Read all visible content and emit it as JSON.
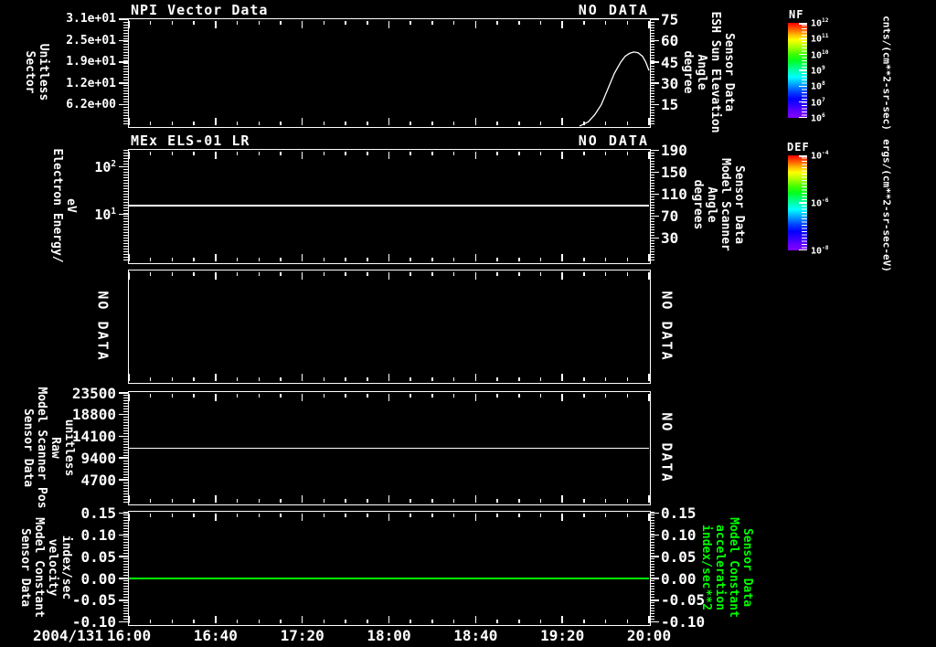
{
  "window": {
    "bg": "#000000",
    "fg": "#ffffff",
    "green": "#00ff00"
  },
  "x_axis": {
    "date_label": "2004/131",
    "tick_labels": [
      "16:00",
      "16:40",
      "17:20",
      "18:00",
      "18:40",
      "19:20",
      "20:00"
    ],
    "minors_between_majors": 3
  },
  "panels": [
    {
      "title": "NPI Vector Data",
      "status_top": "NO DATA",
      "left_label_lines": [
        "Sector",
        "Unitless"
      ],
      "right_label_lines": [
        "Sensor Data",
        "ESH Sun Elevation",
        "Angle",
        "degree"
      ]
    },
    {
      "title": "MEx ELS-01 LR",
      "status_top": "NO DATA",
      "left_label_lines": [
        "Electron Energy/",
        "eV"
      ],
      "right_label_lines": [
        "Sensor Data",
        "Model Scanner",
        "Angle",
        "degrees"
      ]
    },
    {
      "status_left": "NO DATA",
      "status_right": "NO DATA"
    },
    {
      "left_label_lines": [
        "Sensor Data",
        "Model Scanner Pos",
        "Raw",
        "unitless"
      ],
      "status_right": "NO DATA"
    },
    {
      "left_label_lines": [
        "Sensor Data",
        "Model Constant",
        "velocity",
        "index/sec"
      ],
      "right_label_lines": [
        "Sensor Data",
        "Model Constant",
        "acceleration",
        "index/sec**2"
      ],
      "right_label_color": "#00ff00"
    }
  ],
  "colorbars": [
    {
      "name": "NF",
      "unit": "cnts/(cm**2-sr-sec)",
      "tick_labels": [
        "10^12",
        "10^11",
        "10^10",
        "10^9",
        "10^8",
        "10^7",
        "10^6"
      ]
    },
    {
      "name": "DEF",
      "unit": "ergs/(cm**2-sr-sec-eV)",
      "tick_labels": [
        "10^-4",
        "10^-6",
        "10^-8"
      ]
    }
  ],
  "chart_data": [
    {
      "type": "line",
      "panel": 1,
      "title": "NPI Vector Data",
      "no_data": true,
      "x": {
        "date": "2004/131",
        "ticks": [
          "16:00",
          "16:40",
          "17:20",
          "18:00",
          "18:40",
          "19:20",
          "20:00"
        ],
        "range_minutes": [
          0,
          240
        ]
      },
      "y_left": {
        "label": "Sector Unitless",
        "scale": "linear",
        "range": [
          0,
          31
        ],
        "ticks": [
          6.2,
          12.4,
          18.6,
          24.8,
          31
        ],
        "tick_labels": [
          "6.2e+00",
          "1.2e+01",
          "1.9e+01",
          "2.5e+01",
          "3.1e+01"
        ]
      },
      "y_right": {
        "label": "Sensor Data ESH Sun Elevation Angle degree",
        "scale": "linear",
        "range": [
          0,
          75
        ],
        "ticks": [
          15,
          30,
          45,
          60,
          75
        ],
        "tick_labels": [
          "15",
          "30",
          "45",
          "60",
          "75"
        ]
      },
      "series": [
        {
          "type": "curve",
          "name": "ESH Sun Elevation Angle",
          "axis": "right",
          "color": "#ffffff",
          "points": [
            [
              208,
              0
            ],
            [
              210,
              1.5
            ],
            [
              212,
              3
            ],
            [
              215,
              8
            ],
            [
              218,
              15
            ],
            [
              221,
              26
            ],
            [
              224,
              37
            ],
            [
              227,
              45
            ],
            [
              229,
              49
            ],
            [
              231,
              51
            ],
            [
              233,
              52
            ],
            [
              235,
              51.5
            ],
            [
              237,
              49
            ],
            [
              238.5,
              45
            ],
            [
              240,
              39
            ]
          ]
        }
      ]
    },
    {
      "type": "line",
      "panel": 2,
      "title": "MEx ELS-01 LR",
      "no_data": true,
      "y_left": {
        "label": "Electron Energy/eV",
        "scale": "log",
        "range": [
          0.955,
          229
        ],
        "ticks": [
          10,
          100
        ],
        "tick_labels": [
          "10^1",
          "10^2"
        ]
      },
      "y_right": {
        "label": "Sensor Data Model Scanner Angle degrees",
        "scale": "linear",
        "range": [
          -14,
          191
        ],
        "ticks": [
          30,
          70,
          110,
          150,
          190
        ],
        "tick_labels": [
          "30",
          "70",
          "110",
          "150",
          "190"
        ]
      },
      "series": [
        {
          "type": "hline",
          "name": "Electron Energy",
          "axis": "left",
          "color": "#ffffff",
          "value": 15
        }
      ]
    },
    {
      "type": "empty",
      "panel": 3,
      "no_data": true,
      "series": []
    },
    {
      "type": "line",
      "panel": 4,
      "no_data": true,
      "y_left": {
        "label": "Sensor Data Model Scanner Pos Raw unitless",
        "scale": "linear",
        "range": [
          -500,
          23700
        ],
        "ticks": [
          4700,
          9400,
          14100,
          18800,
          23500
        ],
        "tick_labels": [
          "4700",
          "9400",
          "14100",
          "18800",
          "23500"
        ]
      },
      "series": [
        {
          "type": "hline",
          "name": "Model Scanner Pos Raw",
          "axis": "left",
          "color": "#ffffff",
          "value": 11500
        }
      ]
    },
    {
      "type": "line",
      "panel": 5,
      "y_left": {
        "label": "Sensor Data Model Constant velocity index/sec",
        "scale": "linear",
        "range": [
          -0.105,
          0.153
        ],
        "ticks": [
          -0.1,
          -0.05,
          0,
          0.05,
          0.1,
          0.15
        ],
        "tick_labels": [
          "-0.10",
          "-0.05",
          "0.00",
          "0.05",
          "0.10",
          "0.15"
        ]
      },
      "y_right": {
        "label": "Sensor Data Model Constant acceleration index/sec**2",
        "scale": "linear",
        "range": [
          -0.105,
          0.153
        ],
        "ticks": [
          -0.1,
          -0.05,
          0,
          0.05,
          0.1,
          0.15
        ],
        "tick_labels": [
          "-0.10",
          "-0.05",
          "0.00",
          "0.05",
          "0.10",
          "0.15"
        ]
      },
      "series": [
        {
          "type": "hline",
          "name": "Model Constant velocity",
          "axis": "left",
          "color": "#00ff00",
          "value": 0.0
        }
      ]
    }
  ]
}
